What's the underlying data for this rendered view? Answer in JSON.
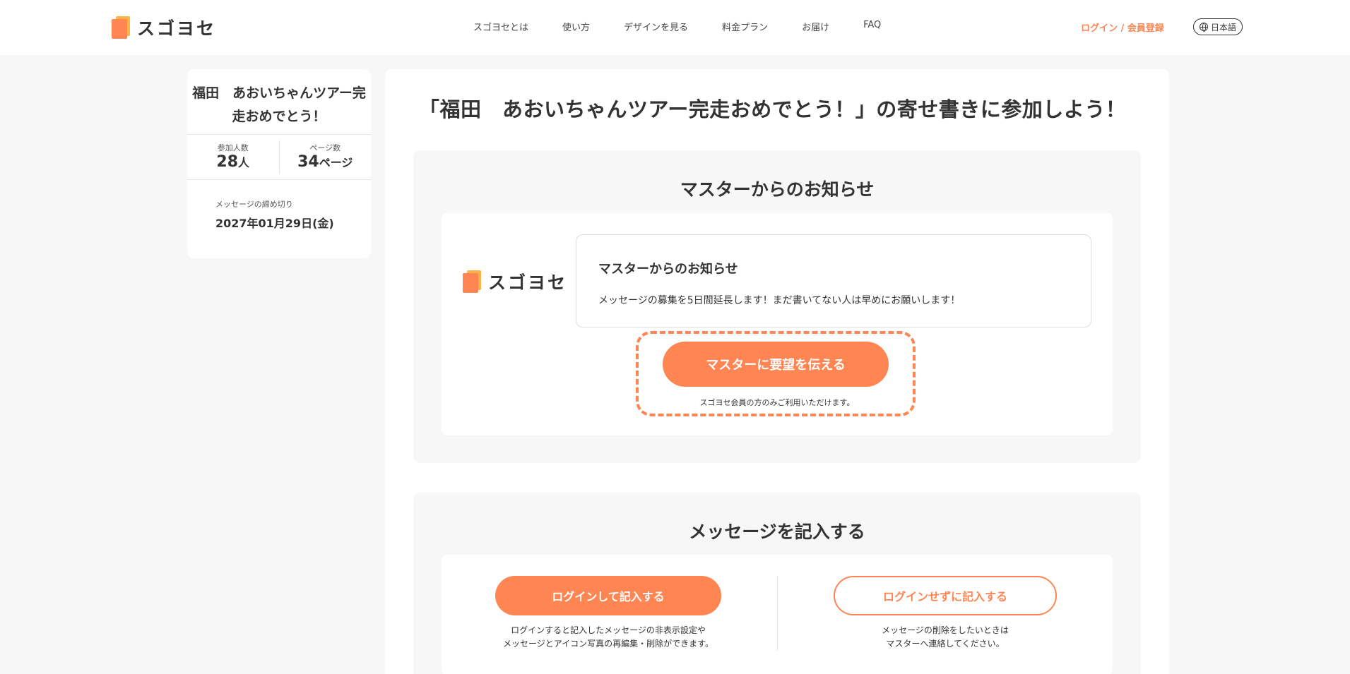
{
  "header": {
    "logo_text": "スゴヨセ",
    "nav": [
      "スゴヨセとは",
      "使い方",
      "デザインを見る",
      "料金プラン",
      "お届け",
      "FAQ"
    ],
    "login_link": "ログイン / 会員登録",
    "language": "日本語"
  },
  "sidebar": {
    "title_line1": "福田　あおいちゃんツアー完",
    "title_line2": "走おめでとう！",
    "participants_label": "参加人数",
    "participants_value": "28",
    "participants_unit": "人",
    "pages_label": "ページ数",
    "pages_value": "34",
    "pages_unit": "ページ",
    "deadline_label": "メッセージの締め切り",
    "deadline_value": "2027年01月29日(金)"
  },
  "main": {
    "title": "「福田　あおいちゃんツアー完走おめでとう！」の寄せ書きに参加しよう！",
    "notice": {
      "heading": "マスターからのお知らせ",
      "logo_text": "スゴヨセ",
      "box_title": "マスターからのお知らせ",
      "box_text": "メッセージの募集を5日間延長します！まだ書いてない人は早めにお願いします！",
      "request_button": "マスターに要望を伝える",
      "request_note": "スゴヨセ会員の方のみご利用いただけます。"
    },
    "write": {
      "heading": "メッセージを記入する",
      "login_button": "ログインして記入する",
      "login_note_line1": "ログインすると記入したメッセージの非表示設定や",
      "login_note_line2": "メッセージとアイコン写真の再編集・削除ができます。",
      "guest_button": "ログインせずに記入する",
      "guest_note_line1": "メッセージの削除をしたいときは",
      "guest_note_line2": "マスターへ連絡してください。"
    }
  },
  "colors": {
    "accent": "#ff8552",
    "logo_secondary": "#ffb347",
    "background": "#f7f7f7"
  }
}
